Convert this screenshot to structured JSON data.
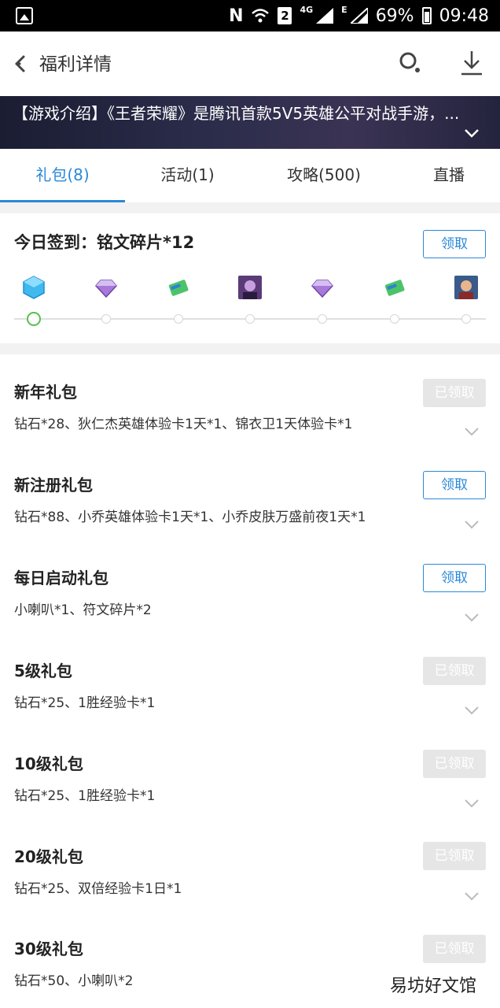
{
  "status_bar": {
    "n_label": "N",
    "sim_label": "2",
    "network_label": "4G",
    "network_label_2": "E",
    "battery": "69%",
    "time": "09:48"
  },
  "header": {
    "title": "福利详情"
  },
  "banner": {
    "text": "【游戏介绍】《王者荣耀》是腾讯首款5V5英雄公平对战手游，..."
  },
  "tabs": [
    {
      "label": "礼包(8)"
    },
    {
      "label": "活动(1)"
    },
    {
      "label": "攻略(500)"
    },
    {
      "label": "直播"
    }
  ],
  "signin": {
    "title": "今日签到：铭文碎片*12",
    "button": "领取",
    "rewards": [
      "blue-crystal-icon",
      "purple-gem-icon",
      "green-card-icon",
      "hero-avatar-icon",
      "purple-gem-icon",
      "green-card-icon",
      "hero-avatar-icon"
    ]
  },
  "gifts": [
    {
      "name": "新年礼包",
      "desc": "钻石*28、狄仁杰英雄体验卡1天*1、锦衣卫1天体验卡*1",
      "button": "已领取"
    },
    {
      "name": "新注册礼包",
      "desc": "钻石*88、小乔英雄体验卡1天*1、小乔皮肤万盛前夜1天*1",
      "button": "领取"
    },
    {
      "name": "每日启动礼包",
      "desc": "小喇叭*1、符文碎片*2",
      "button": "领取"
    },
    {
      "name": "5级礼包",
      "desc": "钻石*25、1胜经验卡*1",
      "button": "已领取"
    },
    {
      "name": "10级礼包",
      "desc": "钻石*25、1胜经验卡*1",
      "button": "已领取"
    },
    {
      "name": "20级礼包",
      "desc": "钻石*25、双倍经验卡1日*1",
      "button": "已领取"
    },
    {
      "name": "30级礼包",
      "desc": "钻石*50、小喇叭*2",
      "button": "已领取"
    }
  ],
  "watermark": "易坊好文馆",
  "colors": {
    "accent": "#2b88d8",
    "claimed_bg": "#e6e6e6",
    "progress_current": "#56c04a"
  }
}
